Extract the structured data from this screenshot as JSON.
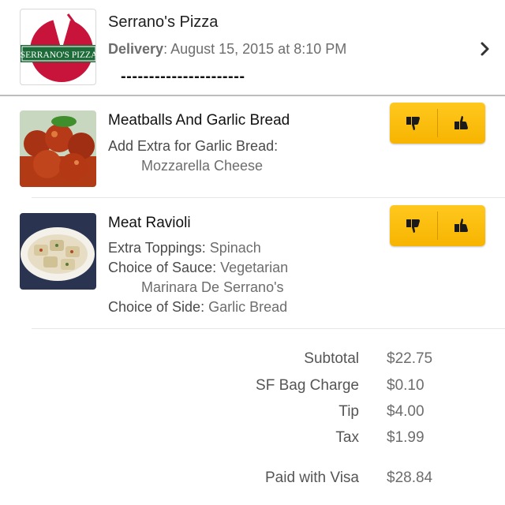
{
  "order": {
    "restaurant": "Serrano's Pizza",
    "logo_text": "SERRANO'S PIZZA",
    "delivery_label": "Delivery",
    "delivery_value": ": August 15, 2015 at 8:10 PM",
    "dashes": "----------------------"
  },
  "items": [
    {
      "name": "Meatballs And Garlic Bread",
      "mods": [
        {
          "key": "Add Extra for Garlic Bread:",
          "value": ""
        },
        {
          "key": "",
          "value": "Mozzarella Cheese"
        }
      ]
    },
    {
      "name": "Meat Ravioli",
      "mods": [
        {
          "key": "Extra Toppings:",
          "value": " Spinach"
        },
        {
          "key": "Choice of Sauce:",
          "value": " Vegetarian"
        },
        {
          "key": "",
          "value": "Marinara De Serrano's"
        },
        {
          "key": "Choice of Side:",
          "value": " Garlic Bread"
        }
      ]
    }
  ],
  "summary": [
    {
      "label": "Subtotal",
      "value": "$22.75"
    },
    {
      "label": "SF Bag Charge",
      "value": "$0.10"
    },
    {
      "label": "Tip",
      "value": "$4.00"
    },
    {
      "label": "Tax",
      "value": "$1.99"
    },
    {
      "label": "Paid with Visa",
      "value": "$28.84"
    }
  ],
  "colors": {
    "rating_button": "#f7b400",
    "accent_red": "#c8102e",
    "logo_green": "#1e6b3a"
  },
  "icons": [
    "thumbs-down-icon",
    "thumbs-up-icon",
    "chevron-right-icon"
  ]
}
